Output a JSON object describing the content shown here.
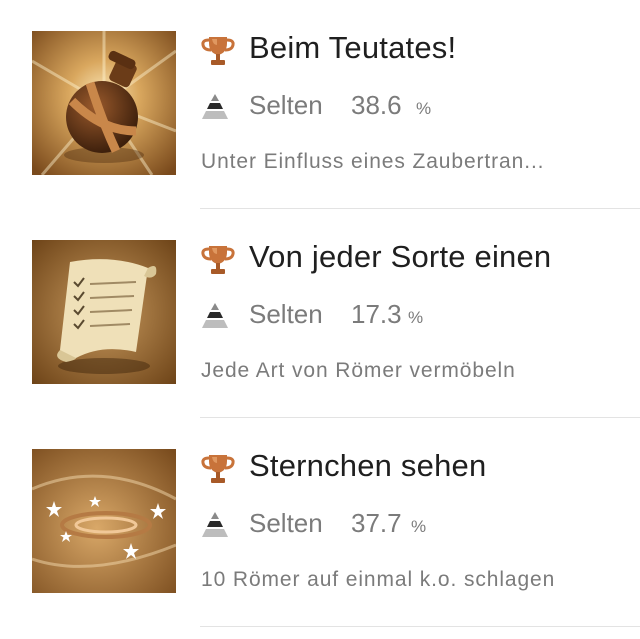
{
  "trophies": [
    {
      "title": "Beim Teutates!",
      "rarity_label": "Selten",
      "rarity_value": "38.6",
      "percent_sign": "%",
      "description": "Unter Einfluss eines Zaubertran...",
      "trophy_icon": "bronze-trophy-icon",
      "rarity_icon": "rarity-pyramid-icon",
      "image": "magic-potion-flask"
    },
    {
      "title": "Von jeder Sorte einen",
      "rarity_label": "Selten",
      "rarity_value": "17.3",
      "percent_sign": "%",
      "description": "Jede Art von Römer vermöbeln",
      "trophy_icon": "bronze-trophy-icon",
      "rarity_icon": "rarity-pyramid-icon",
      "image": "checklist-scroll"
    },
    {
      "title": "Sternchen sehen",
      "rarity_label": "Selten",
      "rarity_value": "37.7",
      "percent_sign": "%",
      "description": "10 Römer auf einmal k.o. schlagen",
      "trophy_icon": "bronze-trophy-icon",
      "rarity_icon": "rarity-pyramid-icon",
      "image": "dizzy-stars-swirl"
    }
  ],
  "colors": {
    "title": "#1f1f1f",
    "secondary_text": "#7b7b7b",
    "bronze": "#c8733a",
    "divider": "#e3e3e3"
  }
}
